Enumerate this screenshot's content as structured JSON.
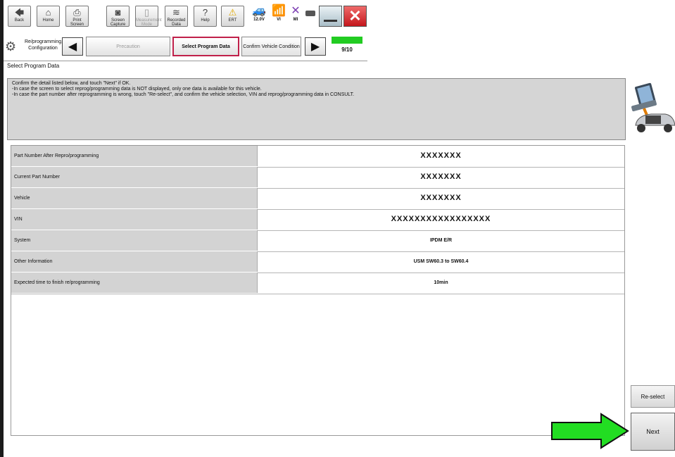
{
  "toolbar": {
    "buttons": [
      {
        "label": "Back"
      },
      {
        "label": "Home"
      },
      {
        "label": "Print Screen"
      },
      {
        "label": "Screen Capture"
      },
      {
        "label": "Measurement Mode"
      },
      {
        "label": "Recorded Data"
      },
      {
        "label": "Help"
      },
      {
        "label": "ERT"
      }
    ],
    "status": {
      "battery": "12.0V",
      "vi": "VI",
      "mi": "MI"
    }
  },
  "breadcrumb": {
    "section": "Re/programming, Configuration",
    "steps": [
      "Precaution",
      "Select Program Data",
      "Confirm Vehicle Condition"
    ],
    "active_step": "Select Program Data",
    "progress": "9/10"
  },
  "page_title": "Select Program Data",
  "info": {
    "lines": [
      "Confirm the detail listed below, and touch \"Next\" if OK.",
      "-In case the screen to select reprog/programming data is NOT displayed, only one data is available for this vehicle.",
      "-In case the part number after reprogramming is wrong, touch \"Re-select\", and confirm the vehicle selection, VIN and reprog/programming data in CONSULT."
    ]
  },
  "table": {
    "rows": [
      {
        "label": "Part Number After Repro/programming",
        "value": "XXXXXXX"
      },
      {
        "label": "Current Part Number",
        "value": "XXXXXXX"
      },
      {
        "label": "Vehicle",
        "value": "XXXXXXX"
      },
      {
        "label": "VIN",
        "value": "XXXXXXXXXXXXXXXXX"
      },
      {
        "label": "System",
        "value": "IPDM E/R"
      },
      {
        "label": "Other Information",
        "value": "USM SW60.3 to SW60.4"
      },
      {
        "label": "Expected time to finish re/programming",
        "value": "10min"
      }
    ]
  },
  "buttons": {
    "reselect": "Re-select",
    "next": "Next"
  },
  "colors": {
    "accent_green": "#22cc22",
    "active_step_border": "#c0204a",
    "close_red": "#d9262c"
  }
}
